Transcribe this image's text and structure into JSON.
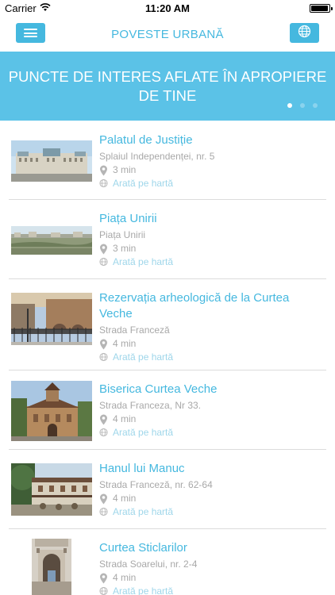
{
  "status_bar": {
    "carrier": "Carrier",
    "time": "11:20 AM"
  },
  "nav": {
    "title": "POVESTE URBANĂ",
    "menu_icon": "hamburger-icon",
    "language_icon": "globe-icon"
  },
  "banner": {
    "text": "PUNCTE DE INTERES AFLATE ÎN APROPIERE DE TINE",
    "page_count": 3,
    "active_page": 1
  },
  "colors": {
    "accent": "#45b8df",
    "banner": "#5bc2e7",
    "muted": "#a8a8a8",
    "link_muted": "#9fd6ea"
  },
  "places": [
    {
      "title": "Palatul de Justiție",
      "address": "Splaiul Independenței, nr. 5",
      "distance": "3 min",
      "map_link": "Arată pe hartă"
    },
    {
      "title": "Piața Unirii",
      "address": "Piața Unirii",
      "distance": "3 min",
      "map_link": "Arată pe hartă"
    },
    {
      "title": "Rezervația arheologică de la Curtea Veche",
      "address": "Strada Franceză",
      "distance": "4 min",
      "map_link": "Arată pe hartă"
    },
    {
      "title": "Biserica Curtea Veche",
      "address": "Strada Franceza, Nr 33.",
      "distance": "4 min",
      "map_link": "Arată pe hartă"
    },
    {
      "title": "Hanul lui Manuc",
      "address": "Strada Franceză, nr. 62-64",
      "distance": "4 min",
      "map_link": "Arată pe hartă"
    },
    {
      "title": "Curtea Sticlarilor",
      "address": "Strada Soarelui, nr. 2-4",
      "distance": "4 min",
      "map_link": "Arată pe hartă"
    }
  ]
}
